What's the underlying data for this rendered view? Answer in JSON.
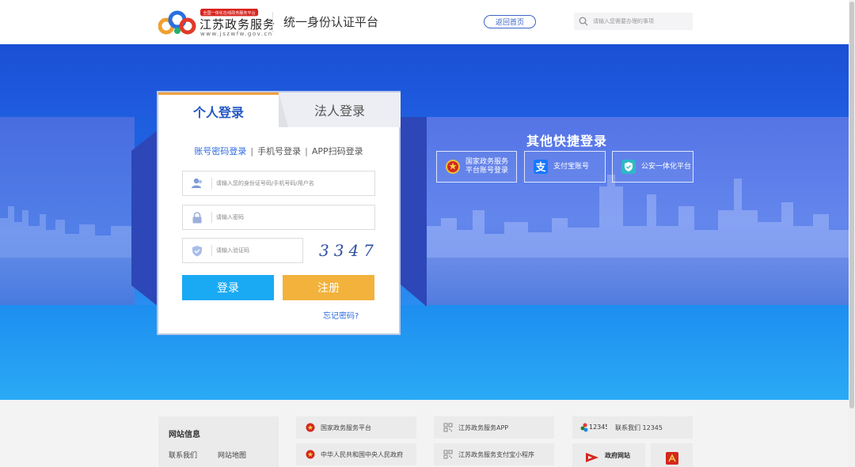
{
  "header": {
    "badge": "全国一体化在线政务服务平台",
    "site_name": "江苏政务服务",
    "site_url": "www.jszwfw.gov.cn",
    "platform_title": "统一身份认证平台",
    "home_button": "返回首页",
    "search_placeholder": "请输入您需要办理的事项"
  },
  "login": {
    "tabs": [
      "个人登录",
      "法人登录"
    ],
    "methods": [
      "账号密码登录",
      "手机号登录",
      "APP扫码登录"
    ],
    "method_sep": "|",
    "username_placeholder": "请输入您的身份证号码/手机号码/用户名",
    "password_placeholder": "请输入密码",
    "captcha_placeholder": "请输入验证码",
    "captcha_value": "3347",
    "login_button": "登录",
    "register_button": "注册",
    "forgot_link": "忘记密码?"
  },
  "quick_login": {
    "title": "其他快捷登录",
    "national_line1": "国家政务服务",
    "national_line2": "平台账号登录",
    "alipay": "支付宝账号",
    "police": "公安一体化平台"
  },
  "footer": {
    "info_title": "网站信息",
    "contact": "联系我们",
    "sitemap": "网站地图",
    "links": [
      "国家政务服务平台",
      "中华人民共和国中央人民政府",
      "江苏政务服务APP",
      "江苏政务服务支付宝小程序"
    ],
    "hotline_logo": "12345",
    "hotline_label": "联系我们 12345",
    "gov_site": "政府网站"
  },
  "colors": {
    "primary_blue": "#2357c5",
    "login_button": "#1aaaf4",
    "register_button": "#f2b23c",
    "tab_accent": "#f0a040"
  }
}
